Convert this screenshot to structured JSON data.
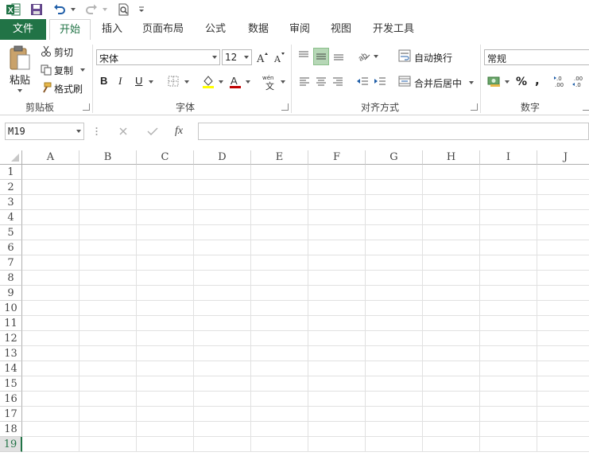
{
  "qat": {
    "icons": [
      "excel-logo-icon",
      "save-icon",
      "undo-icon",
      "redo-icon",
      "print-preview-icon",
      "customize-icon"
    ]
  },
  "tabs": [
    "文件",
    "开始",
    "插入",
    "页面布局",
    "公式",
    "数据",
    "审阅",
    "视图",
    "开发工具"
  ],
  "ribbon": {
    "clipboard": {
      "paste": "粘贴",
      "cut": "剪切",
      "copy": "复制",
      "format_painter": "格式刷",
      "label": "剪贴板"
    },
    "font": {
      "font_name": "宋体",
      "font_size": "12",
      "bold": "B",
      "italic": "I",
      "underline": "U",
      "label": "字体",
      "font_color": "#c00000",
      "highlight_color": "#ffff00"
    },
    "alignment": {
      "wrap_text": "自动换行",
      "merge_center": "合并后居中",
      "label": "对齐方式"
    },
    "number": {
      "format": "常规",
      "percent": "%",
      "comma": ",",
      "label": "数字"
    }
  },
  "formula_bar": {
    "name_box": "M19",
    "fx": "fx",
    "formula": ""
  },
  "grid": {
    "columns": [
      "A",
      "B",
      "C",
      "D",
      "E",
      "F",
      "G",
      "H",
      "I",
      "J"
    ],
    "rows": [
      "1",
      "2",
      "3",
      "4",
      "5",
      "6",
      "7",
      "8",
      "9",
      "10",
      "11",
      "12",
      "13",
      "14",
      "15",
      "16",
      "17",
      "18",
      "19"
    ],
    "selected_row": "19",
    "accent": "#217346"
  }
}
